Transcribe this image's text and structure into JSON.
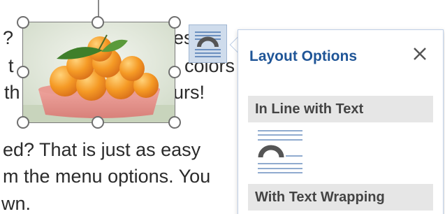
{
  "document": {
    "lines": {
      "l1a": "?",
      "l1b": "es",
      "l2a": "t",
      "l2b": "colors",
      "l3a": "th",
      "l3b": "urs!",
      "l4": "ed?  That is just as easy",
      "l5": "m the menu options.  You",
      "l6": "wn."
    },
    "image": {
      "description_icon": "orange-bowl-image"
    }
  },
  "layout_button": {
    "icon": "layout-options-icon"
  },
  "layout_pane": {
    "title": "Layout Options",
    "close_icon": "close-icon",
    "sections": {
      "inline": "In Line with Text",
      "wrap": "With Text Wrapping"
    },
    "accent_color": "#1f5597"
  }
}
